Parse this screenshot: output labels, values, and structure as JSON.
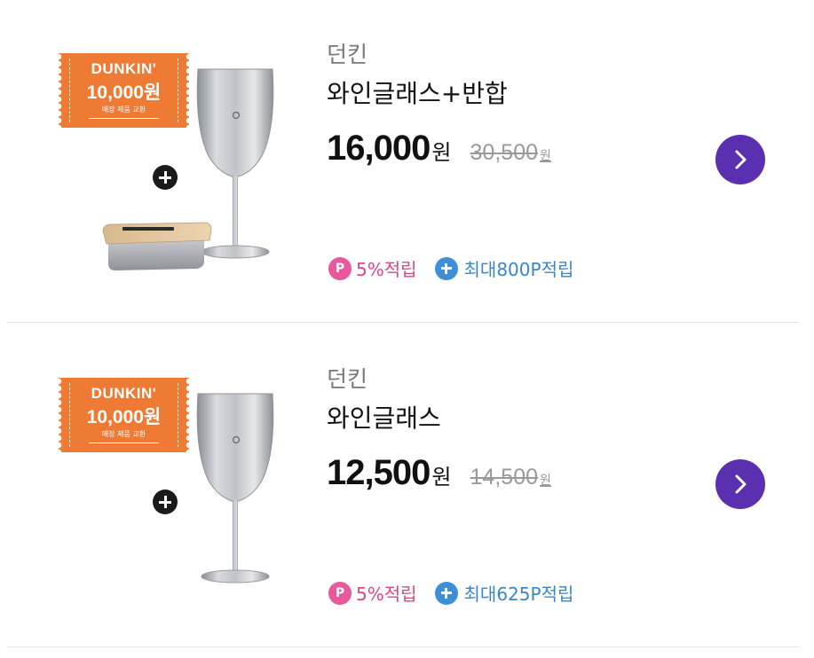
{
  "items": [
    {
      "brand": "던킨",
      "title": "와인글래스+반합",
      "price": "16,000",
      "price_unit": "원",
      "original_price": "30,500",
      "original_unit": "원",
      "coupon": {
        "brand": "DUNKIN'",
        "amount": "10,000원",
        "note": "매장 제품 교환"
      },
      "point_rate": "5%적립",
      "point_badge": "P",
      "max_points": "최대800P적립",
      "has_lunchbox": true
    },
    {
      "brand": "던킨",
      "title": "와인글래스",
      "price": "12,500",
      "price_unit": "원",
      "original_price": "14,500",
      "original_unit": "원",
      "coupon": {
        "brand": "DUNKIN'",
        "amount": "10,000원",
        "note": "매장 제품 교환"
      },
      "point_rate": "5%적립",
      "point_badge": "P",
      "max_points": "최대625P적립",
      "has_lunchbox": false
    }
  ],
  "colors": {
    "coupon_orange": "#ef7a33",
    "arrow_purple": "#5a2fb0",
    "point_pink": "#e8589a",
    "plus_blue": "#3f8fd6"
  },
  "icons": [
    "plus-icon",
    "chevron-right-icon",
    "point-p-icon",
    "plus-circle-icon"
  ]
}
